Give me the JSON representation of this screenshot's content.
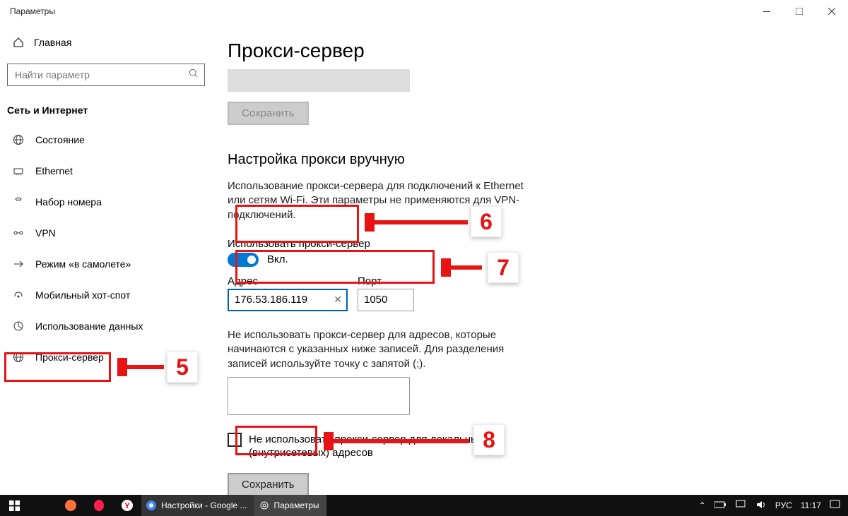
{
  "titlebar": {
    "title": "Параметры"
  },
  "sidebar": {
    "home": "Главная",
    "search_placeholder": "Найти параметр",
    "category": "Сеть и Интернет",
    "items": [
      {
        "label": "Состояние"
      },
      {
        "label": "Ethernet"
      },
      {
        "label": "Набор номера"
      },
      {
        "label": "VPN"
      },
      {
        "label": "Режим «в самолете»"
      },
      {
        "label": "Мобильный хот-спот"
      },
      {
        "label": "Использование данных"
      },
      {
        "label": "Прокси-сервер"
      }
    ]
  },
  "content": {
    "page_title": "Прокси-сервер",
    "save_disabled": "Сохранить",
    "section_title": "Настройка прокси вручную",
    "description": "Использование прокси-сервера для подключений к Ethernet или сетям Wi-Fi. Эти параметры не применяются для VPN-подключений.",
    "toggle_label": "Использовать прокси-сервер",
    "toggle_state": "Вкл.",
    "address_label": "Адрес",
    "address_value": "176.53.186.119",
    "port_label": "Порт",
    "port_value": "1050",
    "exc_desc": "Не использовать прокси-сервер для адресов, которые начинаются с указанных ниже записей. Для разделения записей используйте точку с запятой (;).",
    "exc_value": "",
    "check_label": "Не использовать прокси-сервер для локальных (внутрисетевых) адресов",
    "save": "Сохранить"
  },
  "taskbar": {
    "browser_tab": "Настройки - Google ...",
    "settings_tab": "Параметры",
    "lang": "РУС",
    "time": "11:17"
  },
  "annotations": {
    "n5": "5",
    "n6": "6",
    "n7": "7",
    "n8": "8"
  }
}
